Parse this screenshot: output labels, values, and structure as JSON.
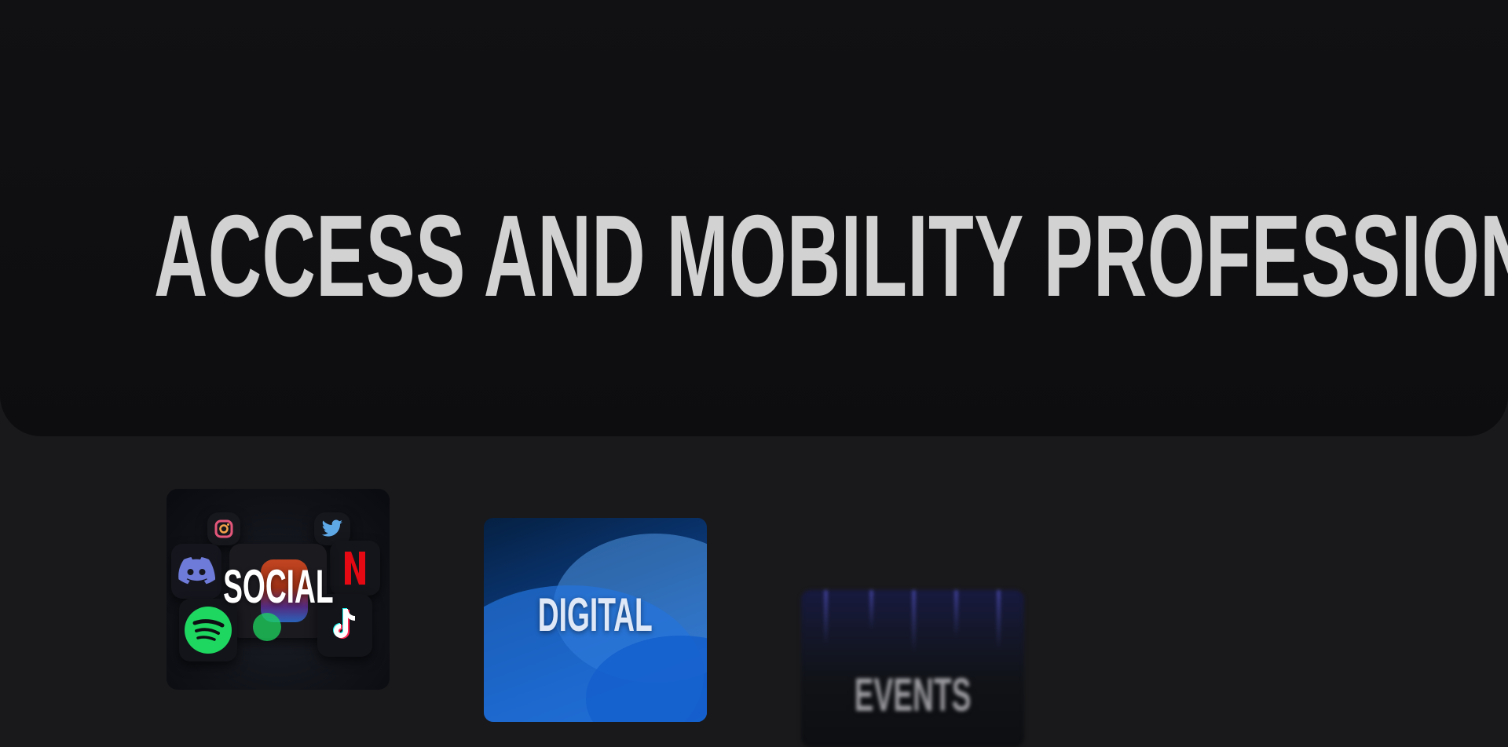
{
  "hero": {
    "title": "ACCESS AND MOBILITY PROFESSIONAL"
  },
  "cards": [
    {
      "label": "SOCIAL",
      "icons": [
        "instagram-icon",
        "twitter-icon",
        "discord-icon",
        "netflix-icon",
        "spotify-icon",
        "tiktok-icon"
      ]
    },
    {
      "label": "DIGITAL"
    },
    {
      "label": "EVENTS"
    }
  ],
  "colors": {
    "page_background": "#19191b",
    "hero_background": "#0f0f11",
    "title_text": "#d2d2d2",
    "digital_blue": "#0e4fae",
    "spotify_green": "#1ed760",
    "netflix_red": "#e50914"
  }
}
